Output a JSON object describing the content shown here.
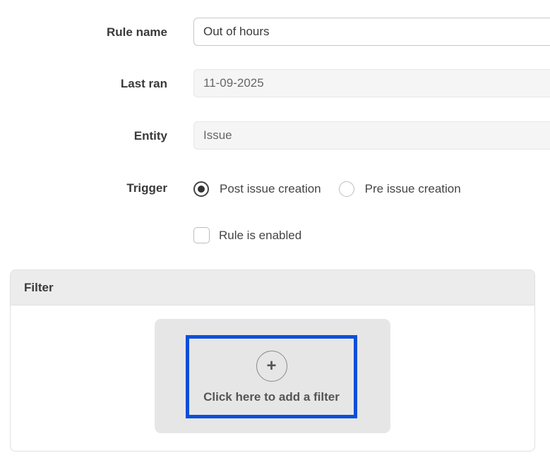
{
  "form": {
    "rule_name": {
      "label": "Rule name",
      "value": "Out of hours"
    },
    "last_ran": {
      "label": "Last ran",
      "value": "11-09-2025"
    },
    "entity": {
      "label": "Entity",
      "value": "Issue"
    },
    "trigger": {
      "label": "Trigger",
      "options": [
        {
          "label": "Post issue creation",
          "checked": true
        },
        {
          "label": "Pre issue creation",
          "checked": false
        }
      ]
    },
    "enabled": {
      "label": "Rule is enabled",
      "checked": false
    }
  },
  "filter": {
    "title": "Filter",
    "add_icon": "plus-icon",
    "add_label": "Click here to add a filter"
  },
  "colors": {
    "highlight_border": "#0a4fd9",
    "drop_zone_bg": "#e6e6e6",
    "panel_header_bg": "#ececec"
  }
}
